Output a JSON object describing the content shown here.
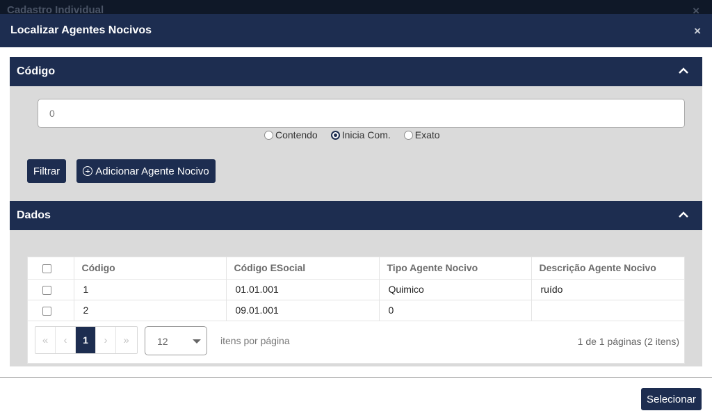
{
  "background": {
    "title": "Cadastro Individual",
    "close_icon": "×"
  },
  "modal": {
    "title": "Localizar Agentes Nocivos",
    "close_icon": "×"
  },
  "filter_panel": {
    "title": "Código",
    "input_value": "0",
    "radios": [
      {
        "label": "Contendo",
        "checked": false
      },
      {
        "label": "Inicia Com.",
        "checked": true
      },
      {
        "label": "Exato",
        "checked": false
      }
    ],
    "filter_button": "Filtrar",
    "add_button": "Adicionar Agente Nocivo"
  },
  "data_panel": {
    "title": "Dados",
    "columns": [
      "Código",
      "Código ESocial",
      "Tipo Agente Nocivo",
      "Descrição Agente Nocivo"
    ],
    "rows": [
      [
        "1",
        "01.01.001",
        "Quimico",
        "ruído"
      ],
      [
        "2",
        "09.01.001",
        "0",
        ""
      ]
    ],
    "pagination": {
      "first": "«",
      "prev": "‹",
      "current": "1",
      "next": "›",
      "last": "»",
      "per_page": "12",
      "per_page_label": "itens por página",
      "page_info": "1 de 1 páginas (2 itens)"
    }
  },
  "footer": {
    "select_button": "Selecionar"
  },
  "colors": {
    "header": "#1d2d50",
    "panel_bg": "#dadada"
  }
}
